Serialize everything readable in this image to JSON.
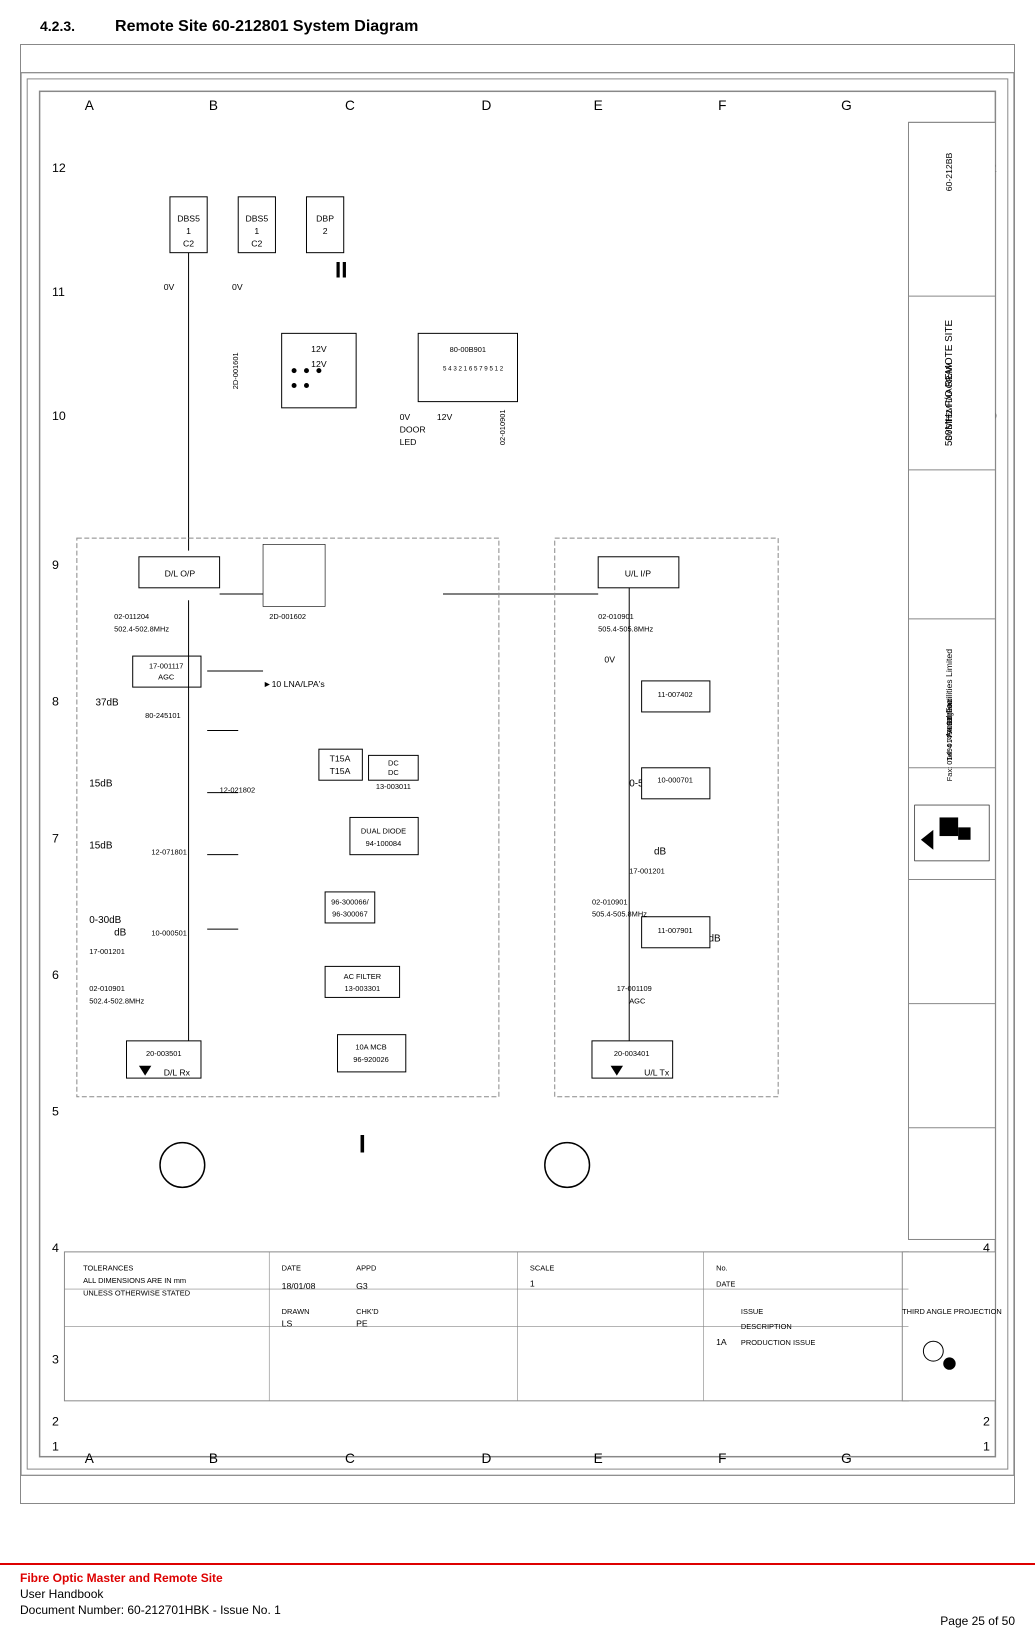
{
  "header": {
    "section_number": "4.2.3.",
    "section_title": "Remote Site 60-212801 System Diagram"
  },
  "footer": {
    "title": "Fibre Optic Master and Remote Site",
    "subtitle": "User Handbook",
    "doc_number": "Document Number: 60-212701HBK - Issue No. 1",
    "page": "Page 25 of 50"
  },
  "diagram": {
    "title": "500MHz F/O REMOTE SITE SYSTEM DIAGRAM",
    "doc_no": "60-212BB",
    "company": "Aerial Facilities Limited",
    "company_addr": "England",
    "tel": "Tel : 01494 777000",
    "fax": "Fax : 01494 777002",
    "drawn_by": "LS",
    "checked": "PE",
    "date": "18/01/08",
    "approved": "G3",
    "issue": "1A",
    "description": "PRODUCTION ISSUE",
    "scale": "1",
    "doc_number": "60-212BB"
  }
}
